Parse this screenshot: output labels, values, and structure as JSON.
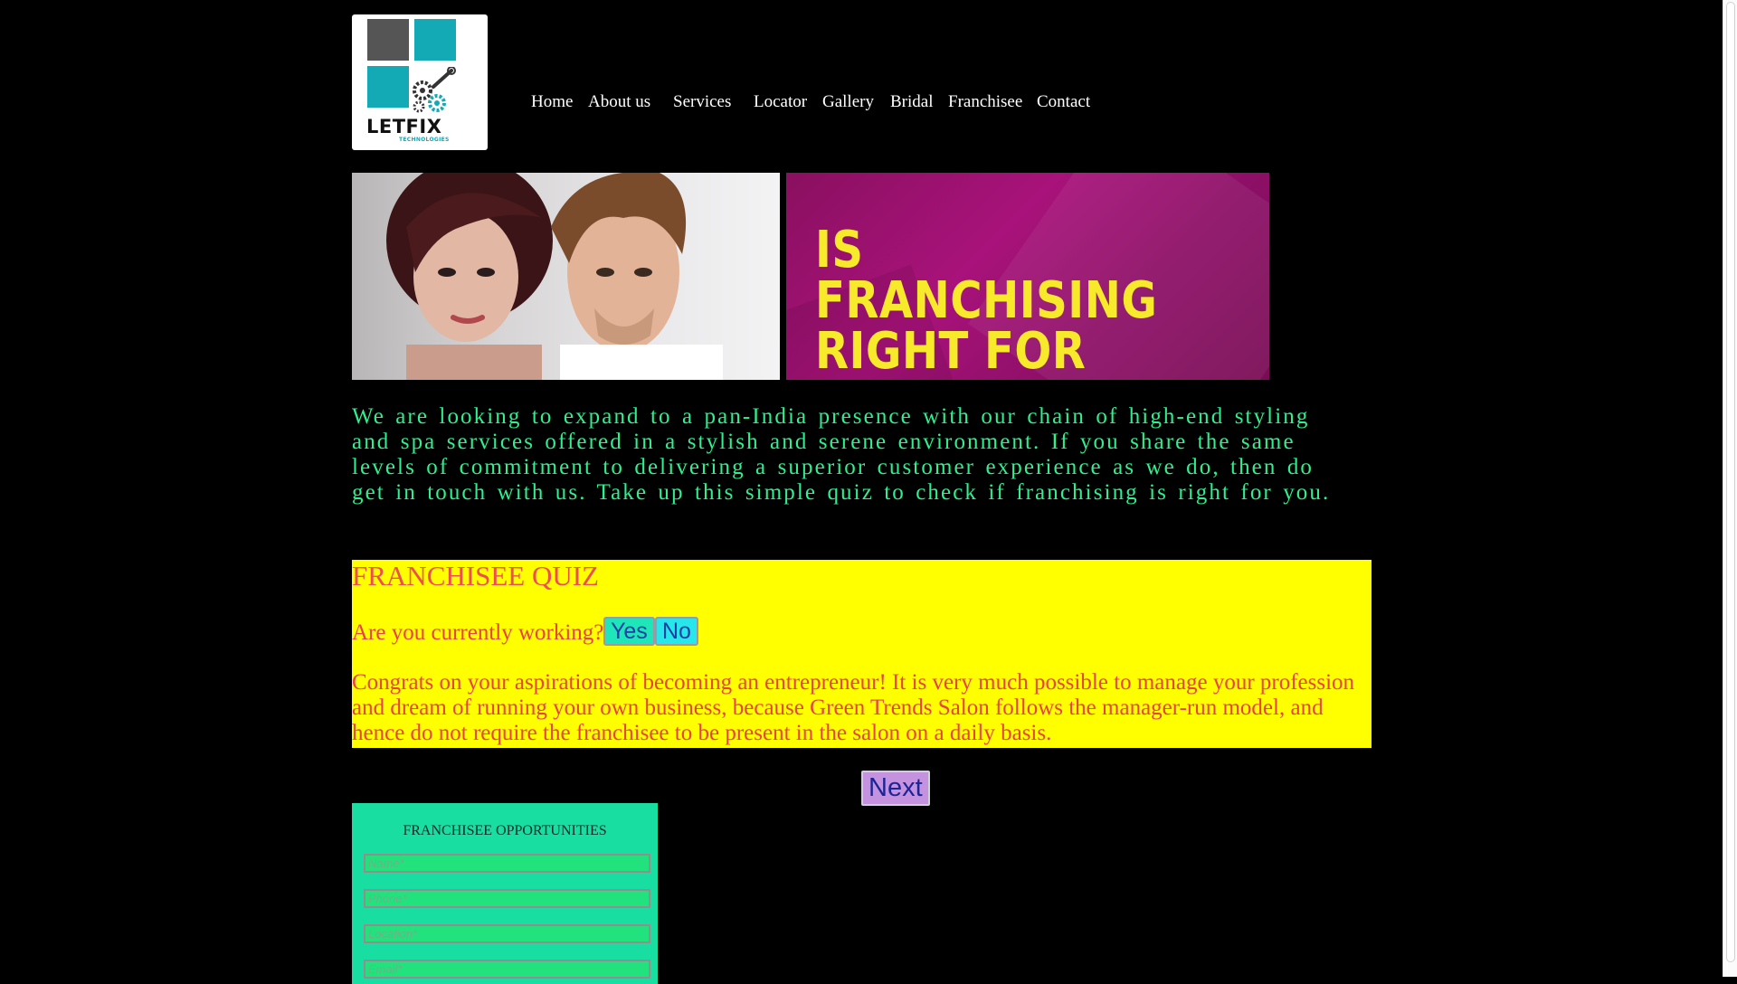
{
  "logo": {
    "brand": "LETFIX",
    "tagline": "TECHNOLOGIES"
  },
  "nav": [
    {
      "label": "Home"
    },
    {
      "label": "About us"
    },
    {
      "label": "Services"
    },
    {
      "label": "Locator"
    },
    {
      "label": "Gallery"
    },
    {
      "label": "Bridal"
    },
    {
      "label": "Franchisee"
    },
    {
      "label": "Contact"
    }
  ],
  "banner": {
    "headline": "IS FRANCHISING RIGHT FOR YOU?"
  },
  "intro": "We are looking to expand to a pan-India presence with our chain of high-end styling and spa services offered in a stylish and serene environment. If you share the same levels of commitment to delivering a superior customer experience as we do, then do get in touch with us. Take up this simple quiz to check if franchising is right for you.",
  "quiz": {
    "title": "FRANCHISEE QUIZ",
    "question": "Are you currently working?",
    "yes_label": "Yes",
    "no_label": "No",
    "answer": "Congrats on your aspirations of becoming an entrepreneur! It is very much possible to manage your profession and dream of running your own business, because Green Trends Salon follows the manager-run model, and hence do not require the franchisee to be present in the salon on a daily basis.",
    "next_label": "Next"
  },
  "form": {
    "title": "FRANCHISEE OPPORTUNITIES",
    "fields": [
      {
        "placeholder": "Name*"
      },
      {
        "placeholder": "Phone*"
      },
      {
        "placeholder": "Location*"
      },
      {
        "placeholder": "Email*"
      }
    ]
  },
  "colors": {
    "background": "#000000",
    "intro_text": "#2ef08f",
    "quiz_bg": "#ffff00",
    "quiz_text": "#e7414a",
    "banner_headline": "#f7ea2a",
    "form_bg": "#18dfa1"
  }
}
